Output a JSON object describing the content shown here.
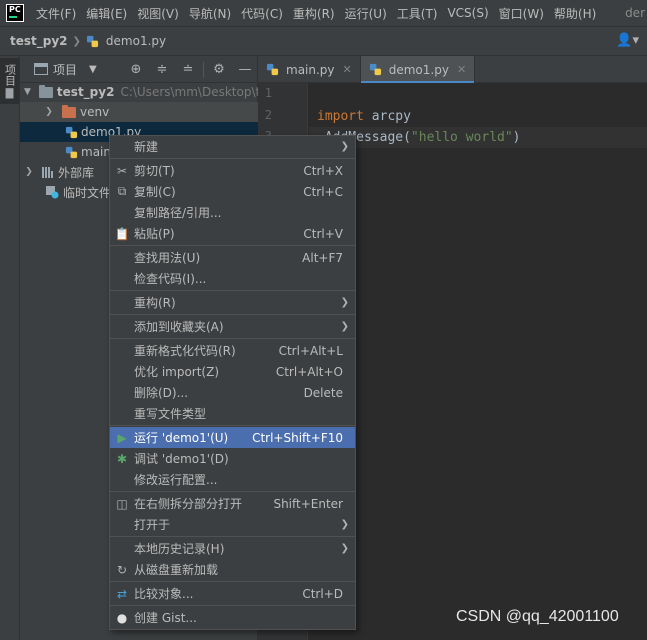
{
  "app": {
    "logo_text": "PC"
  },
  "menubar": {
    "items": [
      "文件(F)",
      "编辑(E)",
      "视图(V)",
      "导航(N)",
      "代码(C)",
      "重构(R)",
      "运行(U)",
      "工具(T)",
      "VCS(S)",
      "窗口(W)",
      "帮助(H)"
    ],
    "title": "der"
  },
  "navbar": {
    "project": "test_py2",
    "file": "demo1.py",
    "user_icon": "user-dropdown-icon"
  },
  "toolstrip": {
    "tab_label": "项目"
  },
  "project_panel": {
    "title": "项目",
    "tools": [
      "locate-icon",
      "expand-all-icon",
      "collapse-all-icon",
      "gear-icon",
      "hide-icon"
    ],
    "tree": {
      "root_name": "test_py2",
      "root_path": "C:\\Users\\mm\\Desktop\\t",
      "venv": "venv",
      "demo1": "demo1.py",
      "main": "main",
      "external": "外部库",
      "scratch": "临时文件"
    }
  },
  "editor": {
    "tabs": [
      {
        "label": "main.py",
        "active": false
      },
      {
        "label": "demo1.py",
        "active": true
      }
    ],
    "line_numbers": [
      "1",
      "2",
      "3"
    ],
    "code": {
      "line2_kw": "import",
      "line2_rest": " arcpy",
      "line3_prefix": ".AddMessage(",
      "line3_str": "\"hello world\"",
      "line3_suffix": ")"
    }
  },
  "context_menu": {
    "items": [
      {
        "label": "新建",
        "icon": "",
        "shortcut": "",
        "submenu": true
      },
      {
        "label": "剪切(T)",
        "icon": "scissors-icon",
        "shortcut": "Ctrl+X"
      },
      {
        "label": "复制(C)",
        "icon": "copy-icon",
        "shortcut": "Ctrl+C"
      },
      {
        "label": "复制路径/引用...",
        "icon": "",
        "shortcut": ""
      },
      {
        "label": "粘贴(P)",
        "icon": "paste-icon",
        "shortcut": "Ctrl+V"
      },
      {
        "label": "查找用法(U)",
        "icon": "",
        "shortcut": "Alt+F7"
      },
      {
        "label": "检查代码(I)...",
        "icon": "",
        "shortcut": ""
      },
      {
        "label": "重构(R)",
        "icon": "",
        "shortcut": "",
        "submenu": true
      },
      {
        "label": "添加到收藏夹(A)",
        "icon": "",
        "shortcut": "",
        "submenu": true
      },
      {
        "label": "重新格式化代码(R)",
        "icon": "",
        "shortcut": "Ctrl+Alt+L"
      },
      {
        "label": "优化 import(Z)",
        "icon": "",
        "shortcut": "Ctrl+Alt+O"
      },
      {
        "label": "删除(D)...",
        "icon": "",
        "shortcut": "Delete"
      },
      {
        "label": "重写文件类型",
        "icon": "",
        "shortcut": ""
      },
      {
        "label": "运行 'demo1'(U)",
        "icon": "run-icon",
        "shortcut": "Ctrl+Shift+F10"
      },
      {
        "label": "调试 'demo1'(D)",
        "icon": "debug-icon",
        "shortcut": ""
      },
      {
        "label": "修改运行配置...",
        "icon": "",
        "shortcut": ""
      },
      {
        "label": "在右侧拆分部分打开",
        "icon": "split-icon",
        "shortcut": "Shift+Enter"
      },
      {
        "label": "打开于",
        "icon": "",
        "shortcut": "",
        "submenu": true
      },
      {
        "label": "本地历史记录(H)",
        "icon": "",
        "shortcut": "",
        "submenu": true
      },
      {
        "label": "从磁盘重新加载",
        "icon": "reload-icon",
        "shortcut": ""
      },
      {
        "label": "比较对象...",
        "icon": "compare-icon",
        "shortcut": "Ctrl+D"
      },
      {
        "label": "创建 Gist...",
        "icon": "github-icon",
        "shortcut": ""
      }
    ]
  },
  "watermark": "CSDN @qq_42001100",
  "colors": {
    "accent": "#4b6eaf",
    "background": "#2b2b2b",
    "panel": "#3c3f41",
    "keyword": "#cc7832",
    "string": "#6a8759"
  }
}
